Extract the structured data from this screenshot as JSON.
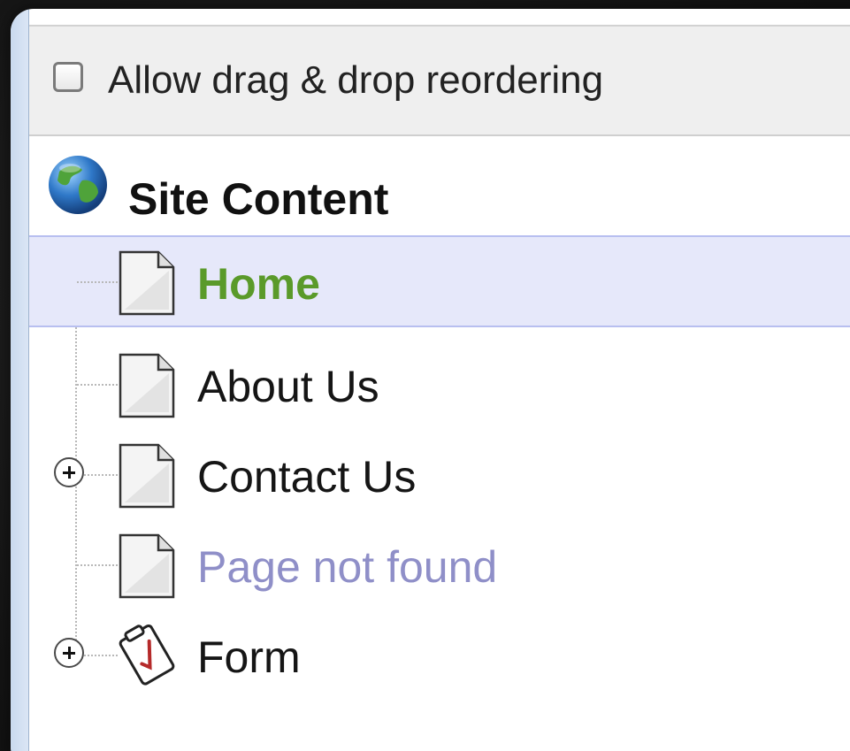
{
  "toolbar": {
    "checkbox_label": "Allow drag & drop reordering",
    "checked": false
  },
  "tree": {
    "root": {
      "label": "Site Content",
      "icon": "globe-icon"
    },
    "items": [
      {
        "label": "Home",
        "icon": "page-icon",
        "selected": true,
        "expandable": false,
        "status": "home"
      },
      {
        "label": "About Us",
        "icon": "page-icon",
        "selected": false,
        "expandable": false,
        "status": "normal"
      },
      {
        "label": "Contact Us",
        "icon": "page-icon",
        "selected": false,
        "expandable": true,
        "status": "normal"
      },
      {
        "label": "Page not found",
        "icon": "page-icon",
        "selected": false,
        "expandable": false,
        "status": "disabled"
      },
      {
        "label": "Form",
        "icon": "form-icon",
        "selected": false,
        "expandable": true,
        "status": "normal"
      }
    ]
  },
  "colors": {
    "home_text": "#5a9a2a",
    "disabled_text": "#8f8fc8",
    "selected_row_bg": "#e6e8fa",
    "toolbar_bg": "#efefef"
  }
}
